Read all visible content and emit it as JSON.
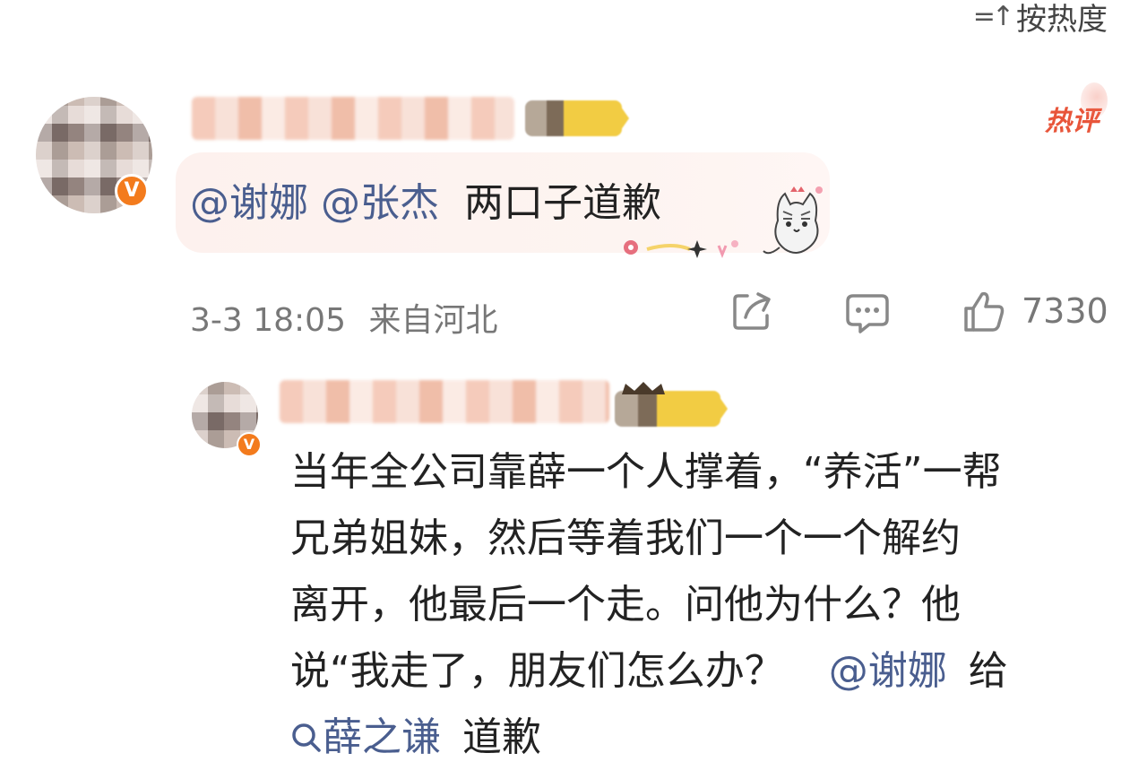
{
  "sort": {
    "label": "按热度",
    "icon": "sort-icon"
  },
  "hot_tag": "热评",
  "comment": {
    "mentions": [
      "@谢娜",
      "@张杰"
    ],
    "text": "两口子道歉",
    "date": "3-3 18:05",
    "location": "来自河北",
    "like_count": "7330"
  },
  "reply": {
    "line1": "当年全公司靠薛一个人撑着，“养活”一帮",
    "line2": "兄弟姐妹，然后等着我们一个一个解约",
    "line3": "离开，他最后一个走。问他为什么？他",
    "line4_text": "说“我走了，朋友们怎么办？",
    "line4_mention": "@谢娜",
    "line4_tail": "给",
    "search_keyword": "薛之谦",
    "line5_tail": "道歉"
  },
  "colors": {
    "mention": "#4a5e8f",
    "hot": "#e8553a",
    "badge": "#f37b1d",
    "vip_gold": "#f2cc43"
  }
}
